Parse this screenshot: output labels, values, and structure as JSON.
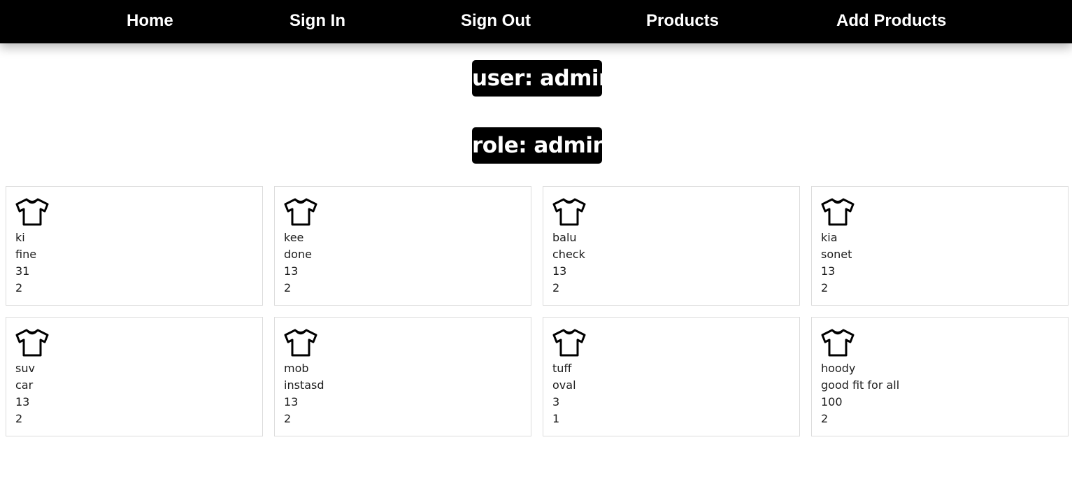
{
  "nav": {
    "items": [
      {
        "label": "Home"
      },
      {
        "label": "Sign In"
      },
      {
        "label": "Sign Out"
      },
      {
        "label": "Products"
      },
      {
        "label": "Add Products"
      }
    ]
  },
  "user_badge": "user: admin",
  "role_badge": "role: admin",
  "products": [
    {
      "icon": "tshirt-icon",
      "name": "ki",
      "description": "fine",
      "price": "31",
      "quantity": "2"
    },
    {
      "icon": "tshirt-icon",
      "name": "kee",
      "description": "done",
      "price": "13",
      "quantity": "2"
    },
    {
      "icon": "tshirt-icon",
      "name": "balu",
      "description": "check",
      "price": "13",
      "quantity": "2"
    },
    {
      "icon": "tshirt-icon",
      "name": "kia",
      "description": "sonet",
      "price": "13",
      "quantity": "2"
    },
    {
      "icon": "tshirt-icon",
      "name": "suv",
      "description": "car",
      "price": "13",
      "quantity": "2"
    },
    {
      "icon": "tshirt-icon",
      "name": "mob",
      "description": "instasd",
      "price": "13",
      "quantity": "2"
    },
    {
      "icon": "tshirt-icon",
      "name": "tuff",
      "description": "oval",
      "price": "3",
      "quantity": "1"
    },
    {
      "icon": "tshirt-icon",
      "name": "hoody",
      "description": "good fit for all",
      "price": "100",
      "quantity": "2"
    }
  ]
}
